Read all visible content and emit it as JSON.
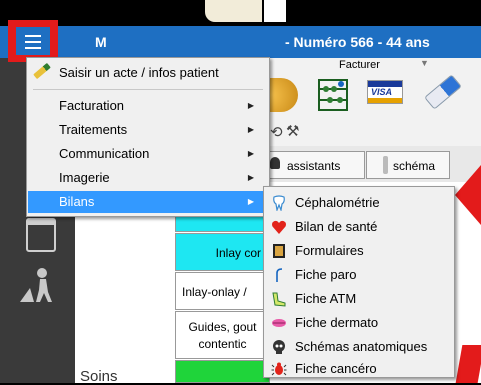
{
  "window": {
    "title_left": "M",
    "title_right": "- Numéro 566  -  44 ans"
  },
  "toolbar": {
    "facturer_label": "Facturer",
    "visa_label": "VISA"
  },
  "tabs": {
    "assistants": "assistants",
    "schema": "schéma"
  },
  "content": {
    "cell1": "Inlay cor",
    "cell2": "Inlay-onlay /",
    "cell3_line1": "Guides, gout",
    "cell3_line2": "contentic",
    "soins": "Soins"
  },
  "menu": {
    "items": [
      {
        "label": "Saisir un acte / infos patient",
        "has_submenu": false
      },
      {
        "label": "Facturation",
        "has_submenu": true
      },
      {
        "label": "Traitements",
        "has_submenu": true
      },
      {
        "label": "Communication",
        "has_submenu": true
      },
      {
        "label": "Imagerie",
        "has_submenu": true
      },
      {
        "label": "Bilans",
        "has_submenu": true,
        "highlighted": true
      }
    ]
  },
  "submenu": {
    "items": [
      {
        "label": "Céphalométrie",
        "icon": "tooth-icon"
      },
      {
        "label": "Bilan de santé",
        "icon": "heart-icon"
      },
      {
        "label": "Formulaires",
        "icon": "notebook-icon"
      },
      {
        "label": "Fiche paro",
        "icon": "probe-icon"
      },
      {
        "label": "Fiche ATM",
        "icon": "jaw-icon"
      },
      {
        "label": "Fiche dermato",
        "icon": "lips-icon"
      },
      {
        "label": "Schémas anatomiques",
        "icon": "skull-icon"
      },
      {
        "label": "Fiche cancéro",
        "icon": "bug-icon"
      }
    ]
  },
  "colors": {
    "titlebar": "#1e6fc2",
    "highlight": "#3399ff",
    "annotation_red": "#e31b1b",
    "cyan_cell": "#1ee7f2",
    "green_cell": "#1fd43a"
  }
}
